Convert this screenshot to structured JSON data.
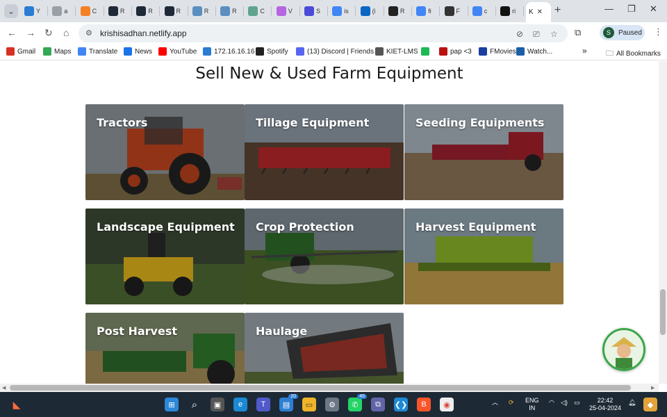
{
  "browser": {
    "tabs": [
      {
        "label": "Y",
        "icon": "s-icon",
        "color": "#2b7cd3"
      },
      {
        "label": "a",
        "icon": "circle-icon",
        "color": "#9aa0a6"
      },
      {
        "label": "C",
        "icon": "stack-icon",
        "color": "#f48024"
      },
      {
        "label": "R",
        "icon": "react-icon",
        "color": "#1f2937"
      },
      {
        "label": "R",
        "icon": "react-icon",
        "color": "#1f2937"
      },
      {
        "label": "R",
        "icon": "react-icon",
        "color": "#1f2937"
      },
      {
        "label": "R",
        "icon": "gear-icon",
        "color": "#5a8fbf"
      },
      {
        "label": "R",
        "icon": "gear-icon",
        "color": "#5a8fbf"
      },
      {
        "label": "C",
        "icon": "c-icon",
        "color": "#5fa58e"
      },
      {
        "label": "V",
        "icon": "v-icon",
        "color": "#b566e0"
      },
      {
        "label": "S",
        "icon": "s-icon",
        "color": "#4a4ad8"
      },
      {
        "label": "is",
        "icon": "google-icon",
        "color": "#4285f4"
      },
      {
        "label": "(i",
        "icon": "linkedin-icon",
        "color": "#0a66c2"
      },
      {
        "label": "R",
        "icon": "wix-icon",
        "color": "#222"
      },
      {
        "label": "fi",
        "icon": "google-icon",
        "color": "#4285f4"
      },
      {
        "label": "F",
        "icon": "eye-icon",
        "color": "#333"
      },
      {
        "label": "c",
        "icon": "google-icon",
        "color": "#4285f4"
      },
      {
        "label": "ri",
        "icon": "github-icon",
        "color": "#111"
      }
    ],
    "active_tab": {
      "label": "K",
      "close": "✕"
    },
    "new_tab": "+",
    "url": "krishisadhan.netlify.app",
    "profile": {
      "initial": "S",
      "status": "Paused"
    },
    "bookmarks": [
      {
        "label": "Gmail",
        "color": "#d93025",
        "icon": "gmail-icon"
      },
      {
        "label": "Maps",
        "color": "#34a853",
        "icon": "maps-icon"
      },
      {
        "label": "Translate",
        "color": "#4285f4",
        "icon": "translate-icon"
      },
      {
        "label": "News",
        "color": "#1a73e8",
        "icon": "news-icon"
      },
      {
        "label": "YouTube",
        "color": "#ff0000",
        "icon": "youtube-icon"
      },
      {
        "label": "172.16.16.16",
        "color": "#2b7cd3",
        "icon": "s-icon"
      },
      {
        "label": "Spotify",
        "color": "#222",
        "icon": "spotify-icon"
      },
      {
        "label": "(13) Discord | Friends",
        "color": "#5865f2",
        "icon": "discord-icon"
      },
      {
        "label": "KIET-LMS",
        "color": "#555",
        "icon": "lms-icon"
      },
      {
        "label": "",
        "color": "#1db954",
        "icon": "spotify-green-icon"
      },
      {
        "label": "pap <3",
        "color": "#b11",
        "icon": "pg-icon"
      },
      {
        "label": "FMovies",
        "color": "#1a3fa0",
        "icon": "fmovies-icon"
      },
      {
        "label": "Watch...",
        "color": "#1b5ea8",
        "icon": "check-icon"
      }
    ],
    "bookmarks_more": "»",
    "all_bookmarks": "All Bookmarks"
  },
  "page": {
    "title": "Sell New & Used Farm Equipment",
    "categories": [
      {
        "label": "Tractors"
      },
      {
        "label": "Tillage Equipment"
      },
      {
        "label": "Seeding Equipments"
      },
      {
        "label": "Landscape Equipment"
      },
      {
        "label": "Crop Protection"
      },
      {
        "label": "Harvest Equipment"
      },
      {
        "label": "Post Harvest"
      },
      {
        "label": "Haulage"
      }
    ]
  },
  "taskbar": {
    "whatsapp_badge": "45",
    "files_badge": "20",
    "lang_line1": "ENG",
    "lang_line2": "IN",
    "time": "22:42",
    "date": "25-04-2024"
  }
}
